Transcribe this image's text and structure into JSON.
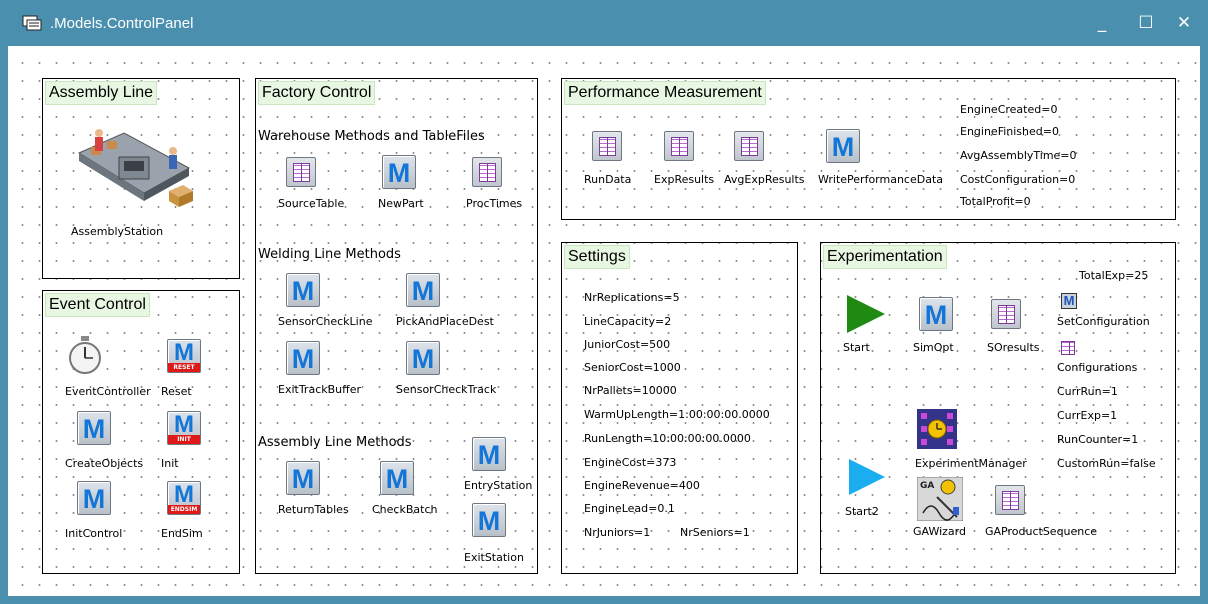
{
  "window": {
    "title": ".Models.ControlPanel",
    "minimize": "_",
    "maximize": "☐",
    "close": "✕"
  },
  "assembly_line": {
    "title": "Assembly Line",
    "station_label": "AssemblyStation"
  },
  "event_control": {
    "title": "Event Control",
    "items": {
      "event_controller": "EventController",
      "reset": "Reset",
      "create_objects": "CreateObjects",
      "init": "Init",
      "init_control": "InitControl",
      "endsim": "EndSim"
    },
    "tags": {
      "reset": "RESET",
      "init": "INIT",
      "endsim": "ENDSIM"
    }
  },
  "factory_control": {
    "title": "Factory Control",
    "warehouse_header": "Warehouse Methods and TableFiles",
    "warehouse": {
      "source_table": "SourceTable",
      "new_part": "NewPart",
      "proc_times": "ProcTimes"
    },
    "welding_header": "Welding Line Methods",
    "welding": {
      "sensor_check_line": "SensorCheckLine",
      "pick_and_place_dest": "PickAndPlaceDest",
      "exit_track_buffer": "ExitTrackBuffer",
      "sensor_check_track": "SensorCheckTrack"
    },
    "assembly_header": "Assembly Line Methods",
    "assembly": {
      "return_tables": "ReturnTables",
      "check_batch": "CheckBatch",
      "entry_station": "EntryStation",
      "exit_station": "ExitStation"
    }
  },
  "performance": {
    "title": "Performance Measurement",
    "items": {
      "run_data": "RunData",
      "exp_results": "ExpResults",
      "avg_exp_results": "AvgExpResults",
      "write_performance_data": "WritePerformanceData"
    },
    "values": [
      "EngineCreated=0",
      "EngineFinished=0",
      "AvgAssemblyTime=0",
      "CostConfiguration=0",
      "TotalProfit=0"
    ]
  },
  "settings": {
    "title": "Settings",
    "values": [
      "NrReplications=5",
      "LineCapacity=2",
      "JuniorCost=500",
      "SeniorCost=1000",
      "NrPallets=10000",
      "WarmUpLength=1:00:00:00.0000",
      "RunLength=10:00:00:00.0000",
      "EngineCost=373",
      "EngineRevenue=400",
      "EngineLead=0.1"
    ],
    "nr_juniors": "NrJuniors=1",
    "nr_seniors": "NrSeniors=1"
  },
  "experimentation": {
    "title": "Experimentation",
    "total_exp": "TotalExp=25",
    "items": {
      "start": "Start",
      "simopt": "SimOpt",
      "soresults": "SOresults",
      "set_configuration": "SetConfiguration",
      "configurations": "Configurations",
      "experiment_manager": "ExperimentManager",
      "start2": "Start2",
      "gawizard": "GAWizard",
      "ga_product_sequence": "GAProductSequence"
    },
    "values": [
      "CurrRun=1",
      "CurrExp=1",
      "RunCounter=1",
      "CustomRun=false"
    ],
    "colors": {
      "start": "#1f8a12",
      "start2": "#1aaef0"
    }
  },
  "icon_glyphs": {
    "method": "M",
    "ga": "GA"
  }
}
